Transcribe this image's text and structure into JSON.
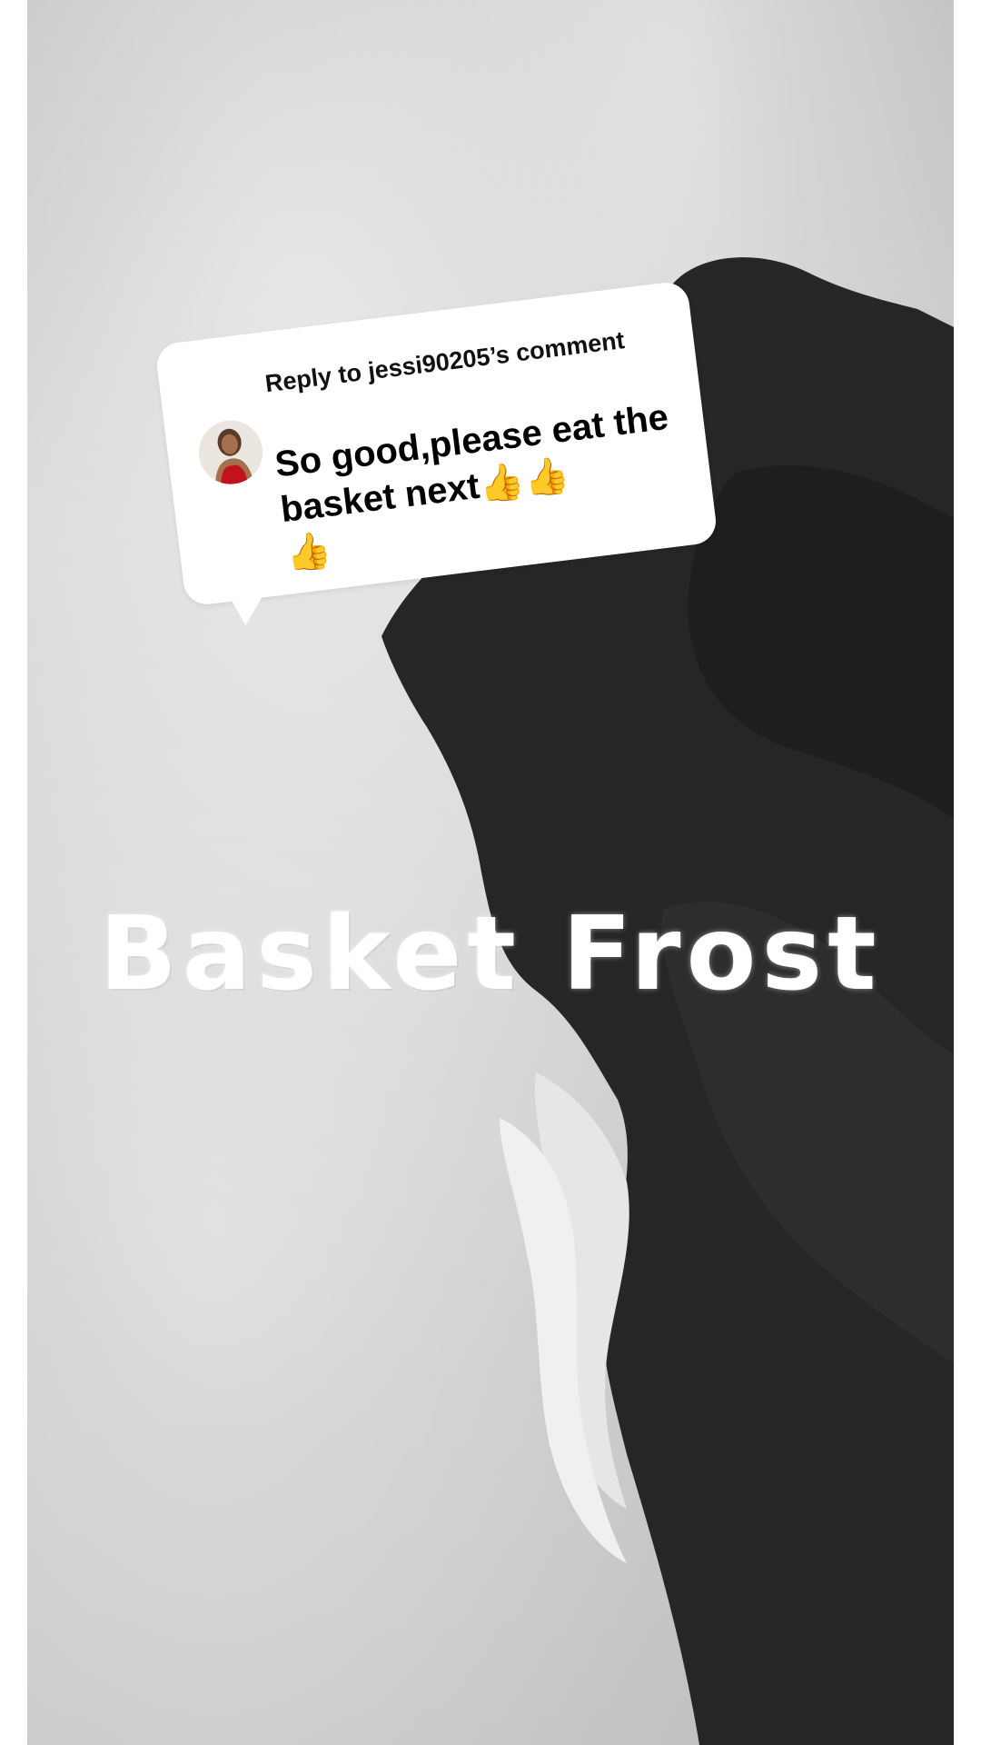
{
  "reply_comment": {
    "header": "Reply to jessi90205’s comment",
    "text": "So good,please eat the basket next👍👍\n👍",
    "avatar_icon": "user-avatar-icon"
  },
  "video": {
    "title_overlay": "Basket Frost"
  },
  "colors": {
    "bubble_background": "#ffffff",
    "overlay_text": "#ffffff",
    "comment_text": "#000000",
    "glove": "#262626",
    "snow": "#d2d2d2"
  }
}
